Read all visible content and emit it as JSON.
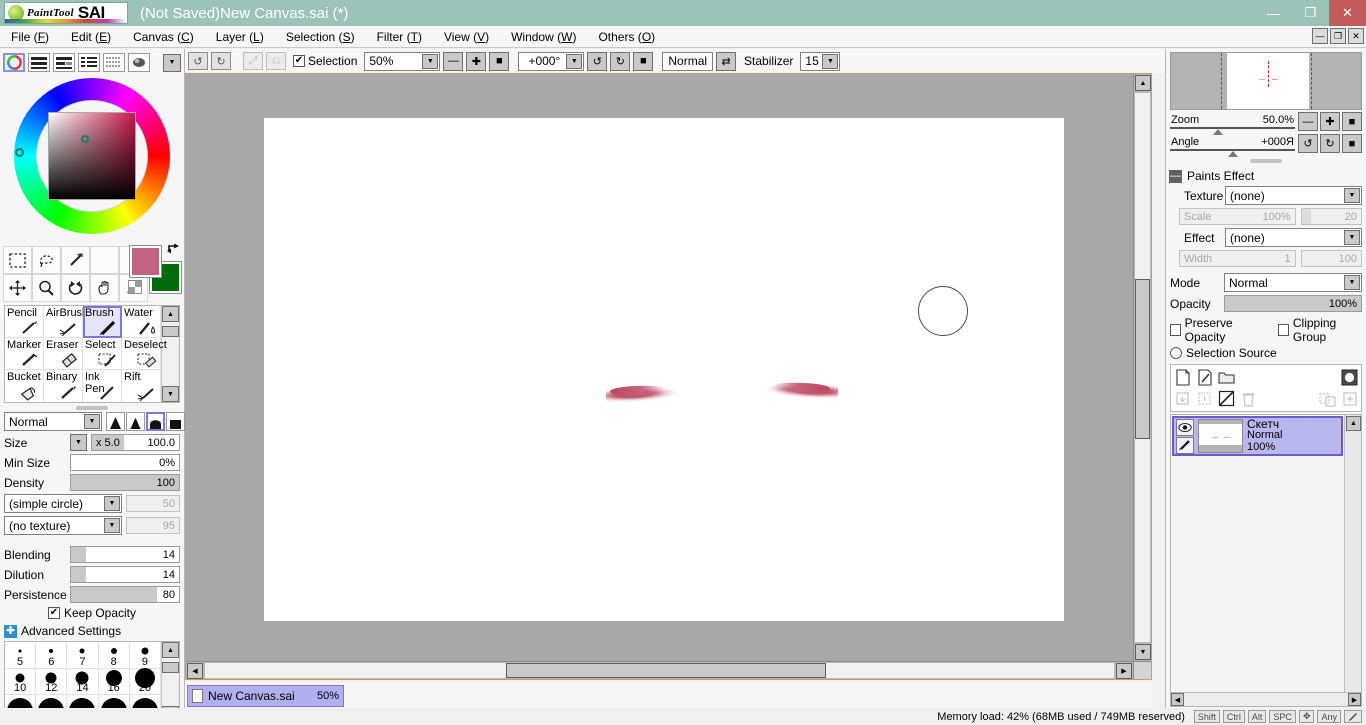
{
  "titlebar": {
    "logo_pt": "PaintTool",
    "logo_sai": "SAI",
    "title": "(Not Saved)New Canvas.sai (*)",
    "minimize": "—",
    "maximize": "❐",
    "close": "✕"
  },
  "menubar": {
    "items": [
      {
        "label": "File",
        "key": "F"
      },
      {
        "label": "Edit",
        "key": "E"
      },
      {
        "label": "Canvas",
        "key": "C"
      },
      {
        "label": "Layer",
        "key": "L"
      },
      {
        "label": "Selection",
        "key": "S"
      },
      {
        "label": "Filter",
        "key": "T"
      },
      {
        "label": "View",
        "key": "V"
      },
      {
        "label": "Window",
        "key": "W"
      },
      {
        "label": "Others",
        "key": "O"
      }
    ],
    "window_buttons": [
      "—",
      "❐",
      "✕"
    ]
  },
  "toolbar": {
    "undo_icon": "↺",
    "redo_icon": "↻",
    "fit_icon": "⤢",
    "rotate_reset_icon": "⎌",
    "selection_label": "Selection",
    "selection_checked": true,
    "zoom_value": "50%",
    "zoom_out": "—",
    "zoom_in": "✚",
    "zoom_reset": "■",
    "angle_value": "+000°",
    "rotate_ccw": "↺",
    "rotate_cw": "↻",
    "angle_reset": "■",
    "flip_label": "Normal",
    "flip_icon": "⇄",
    "stabilizer_label": "Stabilizer",
    "stabilizer_value": "15"
  },
  "left_panel": {
    "palette_icons": [
      "color-wheel-icon",
      "rgb-slider-icon",
      "hsv-slider-icon",
      "color-list-icon",
      "swatch-grid-icon",
      "scratch-pad-icon"
    ],
    "palette_menu_arrow": "▼",
    "colors": {
      "foreground": "#C2647F",
      "background": "#046B0C",
      "swap_icon": "⇄"
    },
    "small_tools": [
      "rect-select-icon",
      "lasso-select-icon",
      "magic-wand-icon",
      "blank-tool-1",
      "blank-tool-2",
      "move-icon",
      "zoom-icon",
      "rotate-icon",
      "hand-icon",
      "eyedropper-icon"
    ],
    "tools": [
      {
        "name": "Pencil",
        "selected": false
      },
      {
        "name": "AirBrush",
        "selected": false
      },
      {
        "name": "Brush",
        "selected": true
      },
      {
        "name": "Water",
        "selected": false
      },
      {
        "name": "Marker",
        "selected": false
      },
      {
        "name": "Eraser",
        "selected": false
      },
      {
        "name": "Select",
        "selected": false
      },
      {
        "name": "Deselect",
        "selected": false
      },
      {
        "name": "Bucket",
        "selected": false
      },
      {
        "name": "Binary",
        "selected": false
      },
      {
        "name": "Ink Pen",
        "selected": false
      },
      {
        "name": "Rift",
        "selected": false
      }
    ],
    "brush": {
      "blend_mode": "Normal",
      "shape_icons": [
        "sharp-tip-icon",
        "soft-tip-icon",
        "round-tip-icon",
        "flat-tip-icon"
      ],
      "shape_selected_index": 2,
      "size_label": "Size",
      "size_multiplier": "x 5.0",
      "size_value": "100.0",
      "min_size_label": "Min Size",
      "min_size_value": "0%",
      "density_label": "Density",
      "density_value": "100",
      "density_fill_pct": 100,
      "shape_name": "(simple circle)",
      "shape_param": "50",
      "texture_name": "(no texture)",
      "texture_param": "95",
      "blending_label": "Blending",
      "blending_value": "14",
      "dilution_label": "Dilution",
      "dilution_value": "14",
      "persistence_label": "Persistence",
      "persistence_value": "80",
      "keep_opacity_label": "Keep Opacity",
      "keep_opacity_checked": true,
      "advanced_label": "Advanced Settings"
    },
    "size_presets": [
      {
        "label": "5",
        "dot": 3
      },
      {
        "label": "6",
        "dot": 4
      },
      {
        "label": "7",
        "dot": 5
      },
      {
        "label": "8",
        "dot": 6
      },
      {
        "label": "9",
        "dot": 7
      },
      {
        "label": "10",
        "dot": 9
      },
      {
        "label": "12",
        "dot": 11
      },
      {
        "label": "14",
        "dot": 13
      },
      {
        "label": "16",
        "dot": 16
      },
      {
        "label": "20",
        "dot": 20
      },
      {
        "label": "",
        "dot": 24
      },
      {
        "label": "",
        "dot": 24
      },
      {
        "label": "",
        "dot": 24
      },
      {
        "label": "",
        "dot": 24
      },
      {
        "label": "",
        "dot": 24
      }
    ]
  },
  "canvas": {
    "background_color": "#A8A8A8",
    "paper_color": "#FFFFFF",
    "stroke_color": "#C0546E",
    "brush_cursor": "circle-cursor",
    "tab": {
      "filename": "New Canvas.sai",
      "zoom": "50%",
      "page_icon": "page-icon"
    }
  },
  "right_panel": {
    "navigator": {
      "zoom_label": "Zoom",
      "zoom_value": "50.0%",
      "angle_label": "Angle",
      "angle_value": "+000Я",
      "zoom_out": "—",
      "zoom_in": "✚",
      "zoom_reset": "■",
      "rotate_ccw": "↺",
      "rotate_cw": "↻",
      "angle_reset": "■"
    },
    "paints_effect": {
      "section_title": "Paints Effect",
      "collapse_icon": "—",
      "texture_label": "Texture",
      "texture_value": "(none)",
      "scale_label": "Scale",
      "scale_value": "100%",
      "scale_param": "20",
      "effect_label": "Effect",
      "effect_value": "(none)",
      "width_label": "Width",
      "width_value": "1",
      "width_param": "100"
    },
    "layer_settings": {
      "mode_label": "Mode",
      "mode_value": "Normal",
      "opacity_label": "Opacity",
      "opacity_value": "100%",
      "preserve_opacity_label": "Preserve Opacity",
      "preserve_opacity_checked": false,
      "clipping_group_label": "Clipping Group",
      "clipping_group_checked": false,
      "selection_source_label": "Selection Source",
      "selection_source_checked": false
    },
    "layer_tools": {
      "new_layer_icon": "new-layer-icon",
      "new_linework_icon": "new-linework-layer-icon",
      "new_folder_icon": "new-folder-icon",
      "mask_icon": "layer-mask-icon",
      "merge_down_icon": "merge-down-icon",
      "merge_group_icon": "merge-group-icon",
      "clear_icon": "clear-layer-icon",
      "delete_icon": "delete-layer-icon",
      "transfer_icon": "transfer-down-icon",
      "add_below_icon": "add-below-icon"
    },
    "layers": [
      {
        "name": "Скетч",
        "mode": "Normal",
        "opacity": "100%",
        "visible": true,
        "selected": true,
        "eye_icon": "eye-icon",
        "edit_icon": "pen-icon"
      }
    ]
  },
  "statusbar": {
    "memory_text": "Memory load: 42% (68MB used / 749MB reserved)",
    "keys": [
      "Shift",
      "Ctrl",
      "Alt",
      "SPC",
      "✥",
      "Any"
    ],
    "pen_icon": "pen-icon"
  }
}
